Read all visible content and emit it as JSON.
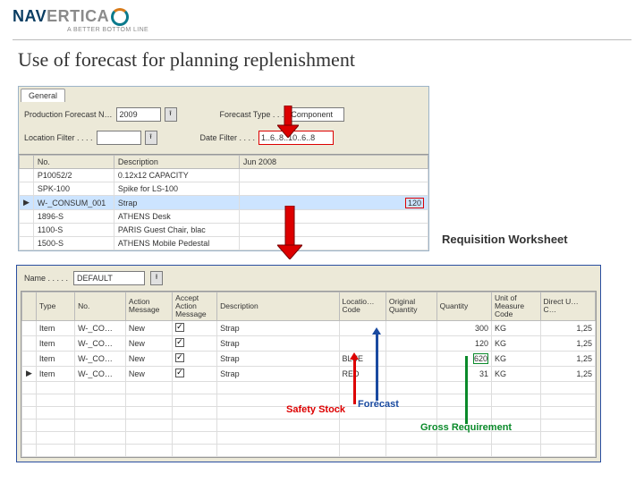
{
  "brand": {
    "name1": "NAV",
    "name2": "ERTICA",
    "tagline": "A BETTER BOTTOM LINE"
  },
  "slide_title": "Use of forecast for planning replenishment",
  "panel1": {
    "tab": "General",
    "labels": {
      "prod_forecast": "Production Forecast N…",
      "location": "Location Filter . . . .",
      "forecast_type": "Forecast Type . . .",
      "date_filter": "Date Filter . . . ."
    },
    "values": {
      "prod_forecast": "2009",
      "forecast_type": "Component",
      "date_filter": "1..6..8..10..6..8"
    },
    "cols": {
      "no": "No.",
      "desc": "Description",
      "date": "Jun 2008"
    },
    "rows": [
      {
        "no": "P10052/2",
        "desc": "0.12x12 CAPACITY"
      },
      {
        "no": "SPK-100",
        "desc": "Spike for LS-100"
      },
      {
        "no": "W-_CONSUM_001",
        "desc": "Strap",
        "val": "120",
        "selected": true
      },
      {
        "no": "1896-S",
        "desc": "ATHENS Desk"
      },
      {
        "no": "1100-S",
        "desc": "PARIS Guest Chair, blac"
      },
      {
        "no": "1500-S",
        "desc": "ATHENS Mobile Pedestal"
      }
    ]
  },
  "req_label": "Requisition Worksheet",
  "panel2": {
    "name_label": "Name . . . . .",
    "name_value": "DEFAULT",
    "cols": {
      "type": "Type",
      "no": "No.",
      "action": "Action Message",
      "accept": "Accept Action Message",
      "desc": "Description",
      "loc": "Locatio… Code",
      "orig": "Original Quantity",
      "qty": "Quantity",
      "uom": "Unit of Measure Code",
      "cost": "Direct U… C…"
    },
    "rows": [
      {
        "type": "Item",
        "no": "W-_CO…",
        "action": "New",
        "desc": "Strap",
        "loc": "",
        "qty": "300",
        "uom": "KG",
        "cost": "1,25"
      },
      {
        "type": "Item",
        "no": "W-_CO…",
        "action": "New",
        "desc": "Strap",
        "loc": "",
        "qty": "120",
        "uom": "KG",
        "cost": "1,25"
      },
      {
        "type": "Item",
        "no": "W-_CO…",
        "action": "New",
        "desc": "Strap",
        "loc": "BLUE",
        "qty": "620",
        "uom": "KG",
        "cost": "1,25",
        "qtybox": true
      },
      {
        "type": "Item",
        "no": "W-_CO…",
        "action": "New",
        "desc": "Strap",
        "loc": "RED",
        "qty": "31",
        "uom": "KG",
        "cost": "1,25",
        "marker": "▶"
      }
    ]
  },
  "annotations": {
    "safety": "Safety Stock",
    "forecast": "Forecast",
    "gross": "Gross Requirement"
  }
}
